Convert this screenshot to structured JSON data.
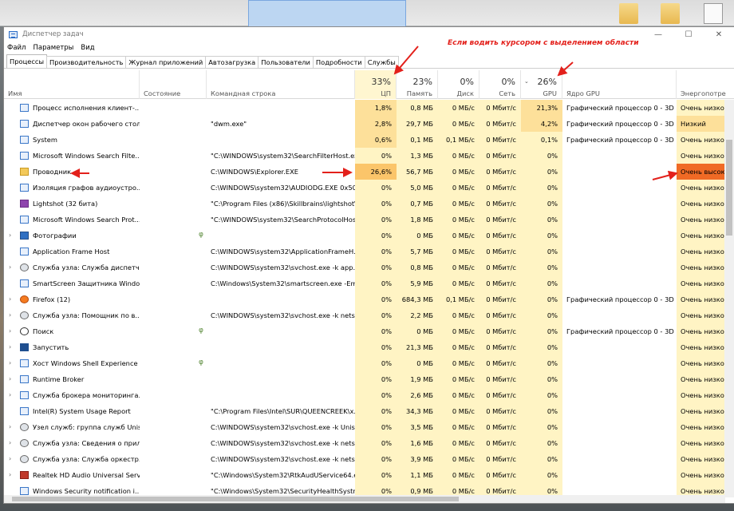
{
  "window": {
    "title": "Диспетчер задач",
    "controls": [
      "—",
      "☐",
      "✕"
    ]
  },
  "menu": [
    "Файл",
    "Параметры",
    "Вид"
  ],
  "tabs": [
    {
      "label": "Процессы",
      "active": true
    },
    {
      "label": "Производительность"
    },
    {
      "label": "Журнал приложений"
    },
    {
      "label": "Автозагрузка"
    },
    {
      "label": "Пользователи"
    },
    {
      "label": "Подробности"
    },
    {
      "label": "Службы"
    }
  ],
  "columns": {
    "name": "Имя",
    "status": "Состояние",
    "cmd": "Командная строка",
    "cpu": {
      "pct": "33%",
      "label": "ЦП"
    },
    "mem": {
      "pct": "23%",
      "label": "Память"
    },
    "disk": {
      "pct": "0%",
      "label": "Диск"
    },
    "net": {
      "pct": "0%",
      "label": "Сеть"
    },
    "gpu": {
      "pct": "26%",
      "label": "GPU"
    },
    "gpu_engine": "Ядро GPU",
    "power": "Энергопотре"
  },
  "annotation": "Если водить курсором с выделением области",
  "rows": [
    {
      "expand": "",
      "icon": "process-icon",
      "name": "Процесс исполнения клиент-...",
      "status": "",
      "cmd": "",
      "cpu": "1,8%",
      "mem": "0,8 МБ",
      "disk": "0 МБ/с",
      "net": "0 Мбит/с",
      "gpu": "21,3%",
      "engine": "Графический процессор 0 - 3D",
      "power": "Очень низкое"
    },
    {
      "expand": "",
      "icon": "process-icon",
      "name": "Диспетчер окон рабочего стола",
      "status": "",
      "cmd": "\"dwm.exe\"",
      "cpu": "2,8%",
      "mem": "29,7 МБ",
      "disk": "0 МБ/с",
      "net": "0 Мбит/с",
      "gpu": "4,2%",
      "engine": "Графический процессор 0 - 3D",
      "power": "Низкий"
    },
    {
      "expand": "",
      "icon": "process-icon",
      "name": "System",
      "status": "",
      "cmd": "",
      "cpu": "0,6%",
      "mem": "0,1 МБ",
      "disk": "0,1 МБ/с",
      "net": "0 Мбит/с",
      "gpu": "0,1%",
      "engine": "Графический процессор 0 - 3D",
      "power": "Очень низкое"
    },
    {
      "expand": "",
      "icon": "process-icon",
      "name": "Microsoft Windows Search Filte...",
      "status": "",
      "cmd": "\"C:\\WINDOWS\\system32\\SearchFilterHost.ex...",
      "cpu": "0%",
      "mem": "1,3 МБ",
      "disk": "0 МБ/с",
      "net": "0 Мбит/с",
      "gpu": "0%",
      "engine": "",
      "power": "Очень низкое"
    },
    {
      "expand": "",
      "icon": "folder-icon",
      "name": "Проводник",
      "status": "",
      "cmd": "C:\\WINDOWS\\Explorer.EXE",
      "cpu": "26,6%",
      "mem": "56,7 МБ",
      "disk": "0 МБ/с",
      "net": "0 Мбит/с",
      "gpu": "0%",
      "engine": "",
      "power": "Очень высоко"
    },
    {
      "expand": "",
      "icon": "process-icon",
      "name": "Изоляция графов аудиоустро...",
      "status": "",
      "cmd": "C:\\WINDOWS\\system32\\AUDIODG.EXE 0x504",
      "cpu": "0%",
      "mem": "5,0 МБ",
      "disk": "0 МБ/с",
      "net": "0 Мбит/с",
      "gpu": "0%",
      "engine": "",
      "power": "Очень низкое"
    },
    {
      "expand": "",
      "icon": "lightshot-icon",
      "name": "Lightshot (32 бита)",
      "status": "",
      "cmd": "\"C:\\Program Files (x86)\\Skillbrains\\lightshot\\...",
      "cpu": "0%",
      "mem": "0,7 МБ",
      "disk": "0 МБ/с",
      "net": "0 Мбит/с",
      "gpu": "0%",
      "engine": "",
      "power": "Очень низкое"
    },
    {
      "expand": "",
      "icon": "process-icon",
      "name": "Microsoft Windows Search Prot...",
      "status": "",
      "cmd": "\"C:\\WINDOWS\\system32\\SearchProtocolHos...",
      "cpu": "0%",
      "mem": "1,8 МБ",
      "disk": "0 МБ/с",
      "net": "0 Мбит/с",
      "gpu": "0%",
      "engine": "",
      "power": "Очень низкое"
    },
    {
      "expand": "›",
      "icon": "photo-icon",
      "name": "Фотографии",
      "status": "leaf",
      "cmd": "",
      "cpu": "0%",
      "mem": "0 МБ",
      "disk": "0 МБ/с",
      "net": "0 Мбит/с",
      "gpu": "0%",
      "engine": "",
      "power": "Очень низкое"
    },
    {
      "expand": "",
      "icon": "process-icon",
      "name": "Application Frame Host",
      "status": "",
      "cmd": "C:\\WINDOWS\\system32\\ApplicationFrameH...",
      "cpu": "0%",
      "mem": "5,7 МБ",
      "disk": "0 МБ/с",
      "net": "0 Мбит/с",
      "gpu": "0%",
      "engine": "",
      "power": "Очень низкое"
    },
    {
      "expand": "›",
      "icon": "gear-icon",
      "name": "Служба узла: Служба диспетч...",
      "status": "",
      "cmd": "C:\\WINDOWS\\system32\\svchost.exe -k app...",
      "cpu": "0%",
      "mem": "0,8 МБ",
      "disk": "0 МБ/с",
      "net": "0 Мбит/с",
      "gpu": "0%",
      "engine": "",
      "power": "Очень низкое"
    },
    {
      "expand": "",
      "icon": "process-icon",
      "name": "SmartScreen Защитника Windo...",
      "status": "",
      "cmd": "C:\\Windows\\System32\\smartscreen.exe -Em...",
      "cpu": "0%",
      "mem": "5,9 МБ",
      "disk": "0 МБ/с",
      "net": "0 Мбит/с",
      "gpu": "0%",
      "engine": "",
      "power": "Очень низкое"
    },
    {
      "expand": "›",
      "icon": "firefox-icon",
      "name": "Firefox (12)",
      "status": "",
      "cmd": "",
      "cpu": "0%",
      "mem": "684,3 МБ",
      "disk": "0,1 МБ/с",
      "net": "0 Мбит/с",
      "gpu": "0%",
      "engine": "Графический процессор 0 - 3D",
      "power": "Очень низкое"
    },
    {
      "expand": "›",
      "icon": "gear-icon",
      "name": "Служба узла: Помощник по в...",
      "status": "",
      "cmd": "C:\\WINDOWS\\system32\\svchost.exe -k netsv...",
      "cpu": "0%",
      "mem": "2,2 МБ",
      "disk": "0 МБ/с",
      "net": "0 Мбит/с",
      "gpu": "0%",
      "engine": "",
      "power": "Очень низкое"
    },
    {
      "expand": "›",
      "icon": "search-icon",
      "name": "Поиск",
      "status": "leaf",
      "cmd": "",
      "cpu": "0%",
      "mem": "0 МБ",
      "disk": "0 МБ/с",
      "net": "0 Мбит/с",
      "gpu": "0%",
      "engine": "Графический процессор 0 - 3D",
      "power": "Очень низкое"
    },
    {
      "expand": "›",
      "icon": "run-icon",
      "name": "Запустить",
      "status": "",
      "cmd": "",
      "cpu": "0%",
      "mem": "21,3 МБ",
      "disk": "0 МБ/с",
      "net": "0 Мбит/с",
      "gpu": "0%",
      "engine": "",
      "power": "Очень низкое"
    },
    {
      "expand": "›",
      "icon": "process-icon",
      "name": "Хост Windows Shell Experience",
      "status": "leaf",
      "cmd": "",
      "cpu": "0%",
      "mem": "0 МБ",
      "disk": "0 МБ/с",
      "net": "0 Мбит/с",
      "gpu": "0%",
      "engine": "",
      "power": "Очень низкое"
    },
    {
      "expand": "›",
      "icon": "process-icon",
      "name": "Runtime Broker",
      "status": "",
      "cmd": "",
      "cpu": "0%",
      "mem": "1,9 МБ",
      "disk": "0 МБ/с",
      "net": "0 Мбит/с",
      "gpu": "0%",
      "engine": "",
      "power": "Очень низкое"
    },
    {
      "expand": "›",
      "icon": "process-icon",
      "name": "Служба брокера мониторинга...",
      "status": "",
      "cmd": "",
      "cpu": "0%",
      "mem": "2,6 МБ",
      "disk": "0 МБ/с",
      "net": "0 Мбит/с",
      "gpu": "0%",
      "engine": "",
      "power": "Очень низкое"
    },
    {
      "expand": "",
      "icon": "process-icon",
      "name": "Intel(R) System Usage Report",
      "status": "",
      "cmd": "\"C:\\Program Files\\Intel\\SUR\\QUEENCREEK\\x...",
      "cpu": "0%",
      "mem": "34,3 МБ",
      "disk": "0 МБ/с",
      "net": "0 Мбит/с",
      "gpu": "0%",
      "engine": "",
      "power": "Очень низкое"
    },
    {
      "expand": "›",
      "icon": "gear-icon",
      "name": "Узел служб: группа служб Unis...",
      "status": "",
      "cmd": "C:\\WINDOWS\\system32\\svchost.exe -k Unist...",
      "cpu": "0%",
      "mem": "3,5 МБ",
      "disk": "0 МБ/с",
      "net": "0 Мбит/с",
      "gpu": "0%",
      "engine": "",
      "power": "Очень низкое"
    },
    {
      "expand": "›",
      "icon": "gear-icon",
      "name": "Служба узла: Сведения о прил...",
      "status": "",
      "cmd": "C:\\WINDOWS\\system32\\svchost.exe -k netsv...",
      "cpu": "0%",
      "mem": "1,6 МБ",
      "disk": "0 МБ/с",
      "net": "0 Мбит/с",
      "gpu": "0%",
      "engine": "",
      "power": "Очень низкое"
    },
    {
      "expand": "›",
      "icon": "gear-icon",
      "name": "Служба узла: Служба оркестр...",
      "status": "",
      "cmd": "C:\\WINDOWS\\system32\\svchost.exe -k netsv...",
      "cpu": "0%",
      "mem": "3,9 МБ",
      "disk": "0 МБ/с",
      "net": "0 Мбит/с",
      "gpu": "0%",
      "engine": "",
      "power": "Очень низкое"
    },
    {
      "expand": "›",
      "icon": "audio-icon",
      "name": "Realtek HD Audio Universal Serv...",
      "status": "",
      "cmd": "\"C:\\Windows\\System32\\RtkAudUService64.e...",
      "cpu": "0%",
      "mem": "1,1 МБ",
      "disk": "0 МБ/с",
      "net": "0 Мбит/с",
      "gpu": "0%",
      "engine": "",
      "power": "Очень низкое"
    },
    {
      "expand": "",
      "icon": "process-icon",
      "name": "Windows Security notification i...",
      "status": "",
      "cmd": "\"C:\\Windows\\System32\\SecurityHealthSystra...",
      "cpu": "0%",
      "mem": "0,9 МБ",
      "disk": "0 МБ/с",
      "net": "0 Мбит/с",
      "gpu": "0%",
      "engine": "",
      "power": "Очень низкое"
    }
  ]
}
